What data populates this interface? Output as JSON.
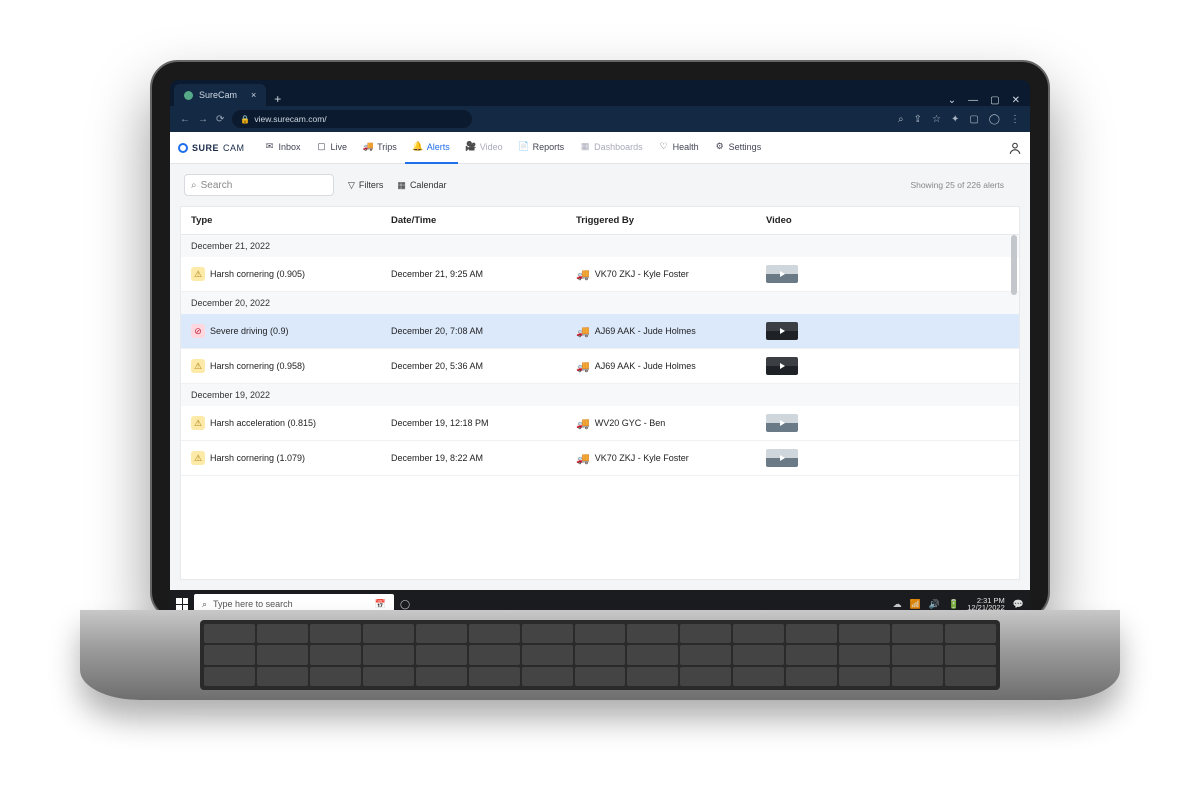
{
  "browser": {
    "tab_title": "SureCam",
    "url_host": "view.surecam.com/",
    "window_controls": {
      "minimize": "—",
      "maximize": "▢",
      "close": "✕",
      "chevron": "⌄"
    }
  },
  "brand": {
    "name_left": "SURE",
    "name_right": "CAM"
  },
  "nav": {
    "items": [
      {
        "label": "Inbox",
        "icon": "inbox-icon"
      },
      {
        "label": "Live",
        "icon": "live-icon"
      },
      {
        "label": "Trips",
        "icon": "trips-icon"
      },
      {
        "label": "Alerts",
        "icon": "alerts-icon",
        "active": true
      },
      {
        "label": "Video",
        "icon": "video-icon",
        "disabled": true
      },
      {
        "label": "Reports",
        "icon": "reports-icon"
      },
      {
        "label": "Dashboards",
        "icon": "dashboards-icon",
        "disabled": true
      },
      {
        "label": "Health",
        "icon": "health-icon"
      },
      {
        "label": "Settings",
        "icon": "settings-icon"
      }
    ]
  },
  "toolbar": {
    "search_placeholder": "Search",
    "filters_label": "Filters",
    "calendar_label": "Calendar"
  },
  "results": {
    "text": "Showing 25 of 226 alerts"
  },
  "table": {
    "headers": {
      "type": "Type",
      "date": "Date/Time",
      "triggered": "Triggered By",
      "video": "Video"
    },
    "groups": [
      {
        "label": "December 21, 2022",
        "rows": [
          {
            "name": "Harsh cornering (0.905)",
            "severity": "warn",
            "date": "December 21, 9:25 AM",
            "triggered": "VK70 ZKJ - Kyle Foster",
            "thumb": "light"
          }
        ]
      },
      {
        "label": "December 20, 2022",
        "rows": [
          {
            "name": "Severe driving (0.9)",
            "severity": "severe",
            "date": "December 20, 7:08 AM",
            "triggered": "AJ69 AAK - Jude Holmes",
            "thumb": "dark",
            "selected": true
          },
          {
            "name": "Harsh cornering (0.958)",
            "severity": "warn",
            "date": "December 20, 5:36 AM",
            "triggered": "AJ69 AAK - Jude Holmes",
            "thumb": "dark"
          }
        ]
      },
      {
        "label": "December 19, 2022",
        "rows": [
          {
            "name": "Harsh acceleration (0.815)",
            "severity": "warn",
            "date": "December 19, 12:18 PM",
            "triggered": "WV20 GYC - Ben",
            "thumb": "light"
          },
          {
            "name": "Harsh cornering (1.079)",
            "severity": "warn",
            "date": "December 19, 8:22 AM",
            "triggered": "VK70 ZKJ - Kyle Foster",
            "thumb": "light"
          }
        ]
      }
    ]
  },
  "taskbar": {
    "search_placeholder": "Type here to search",
    "time": "2:31 PM",
    "date": "12/21/2022"
  }
}
